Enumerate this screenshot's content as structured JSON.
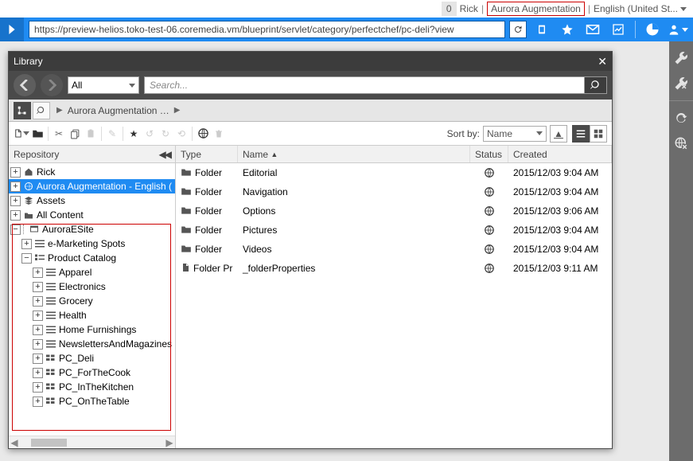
{
  "topbar": {
    "count": "0",
    "user": "Rick",
    "site": "Aurora Augmentation",
    "lang": "English (United St..."
  },
  "bluebar": {
    "url": "https://preview-helios.toko-test-06.coremedia.vm/blueprint/servlet/category/perfectchef/pc-deli?view"
  },
  "library": {
    "title": "Library",
    "type_filter": "All",
    "search_placeholder": "Search...",
    "breadcrumb": "Aurora Augmentation …",
    "sort_label": "Sort by:",
    "sort_value": "Name",
    "repo_label": "Repository",
    "cols": {
      "type": "Type",
      "name": "Name",
      "status": "Status",
      "created": "Created"
    },
    "sort_indicator": "▲"
  },
  "tree": {
    "n0": "Rick",
    "n1": "Aurora Augmentation - English (",
    "n2": "Assets",
    "n3": "All Content",
    "n4": "AuroraESite",
    "n5": "e-Marketing Spots",
    "n6": "Product Catalog",
    "n7": "Apparel",
    "n8": "Electronics",
    "n9": "Grocery",
    "n10": "Health",
    "n11": "Home Furnishings",
    "n12": "NewslettersAndMagazines",
    "n13": "PC_Deli",
    "n14": "PC_ForTheCook",
    "n15": "PC_InTheKitchen",
    "n16": "PC_OnTheTable"
  },
  "rows": [
    {
      "type": "Folder",
      "name": "Editorial",
      "created": "2015/12/03 9:04 AM"
    },
    {
      "type": "Folder",
      "name": "Navigation",
      "created": "2015/12/03 9:04 AM"
    },
    {
      "type": "Folder",
      "name": "Options",
      "created": "2015/12/03 9:06 AM"
    },
    {
      "type": "Folder",
      "name": "Pictures",
      "created": "2015/12/03 9:04 AM"
    },
    {
      "type": "Folder",
      "name": "Videos",
      "created": "2015/12/03 9:04 AM"
    },
    {
      "type": "Folder Pr",
      "name": "_folderProperties",
      "created": "2015/12/03 9:11 AM",
      "doc": true
    }
  ]
}
